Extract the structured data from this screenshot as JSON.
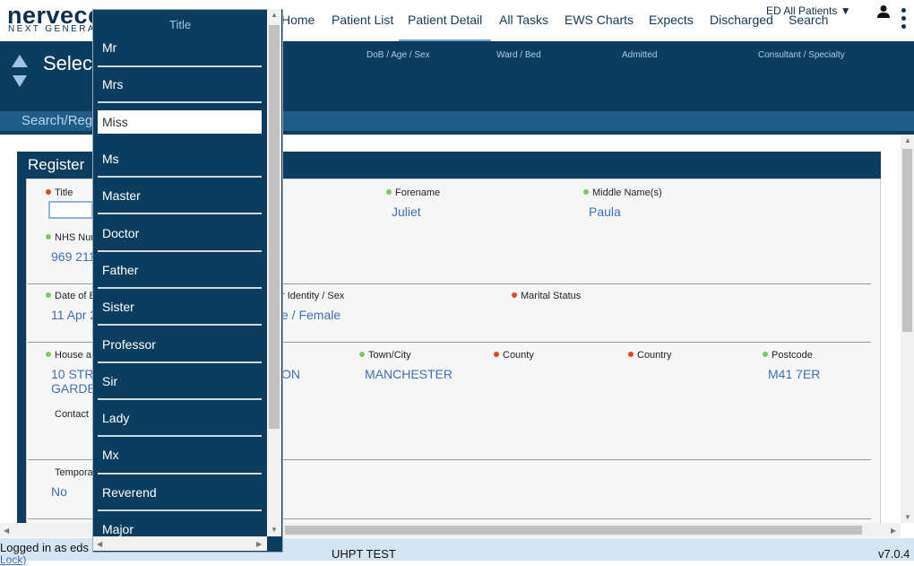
{
  "app": {
    "logo_main": "nervece",
    "logo_sub": "NEXT GENERAT"
  },
  "nav": {
    "items": [
      "Home",
      "Patient List",
      "Patient Detail",
      "All Tasks",
      "EWS Charts",
      "Expects",
      "Discharged",
      "Search"
    ],
    "active": "Patient Detail",
    "ward_selector": "ED All Patients ▼"
  },
  "header": {
    "select_text": "Selec",
    "columns": [
      "DoB / Age / Sex",
      "Ward / Bed",
      "Admitted",
      "Consultant / Specialty"
    ],
    "search_text": "Search/Reg"
  },
  "form": {
    "card_title": "Register",
    "fields": {
      "title_label": "Title",
      "forename_label": "Forename",
      "forename_value": "Juliet",
      "middle_label": "Middle Name(s)",
      "middle_value": "Paula",
      "nhs_label": "NHS Num",
      "nhs_value": "969 211",
      "dob_label": "Date of B",
      "dob_value": "11 Apr 2",
      "gender_label": "r Identity / Sex",
      "gender_value": "e / Female",
      "marital_label": "Marital Status",
      "house_label": "House a",
      "house_value_1": "10 STR",
      "house_value_2": "GARDE",
      "street_value": "ON",
      "town_label": "Town/City",
      "town_value": "MANCHESTER",
      "county_label": "County",
      "country_label": "Country",
      "postcode_label": "Postcode",
      "postcode_value": "M41 7ER",
      "contact_label": "Contact",
      "temporary_label": "Tempora",
      "temporary_value": "No"
    }
  },
  "dropdown": {
    "title": "Title",
    "options": [
      "Mr",
      "Mrs",
      "Miss",
      "Ms",
      "Master",
      "Doctor",
      "Father",
      "Sister",
      "Professor",
      "Sir",
      "Lady",
      "Mx",
      "Reverend",
      "Major"
    ],
    "highlighted": "Miss"
  },
  "footer": {
    "logged_in": "Logged in as eds",
    "environment": "UHPT TEST",
    "version": "v7.0.4",
    "lock_text": "Lock)"
  },
  "colors": {
    "navy": "#0d3d5e",
    "link_blue": "#3e6fb8",
    "required_dot": "#e8471e",
    "valid_dot": "#7dc95a"
  }
}
